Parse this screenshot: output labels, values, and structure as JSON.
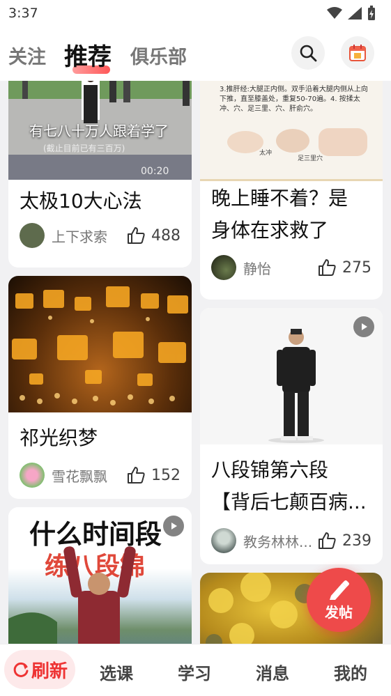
{
  "status": {
    "time": "3:37"
  },
  "tabs": {
    "follow": "关注",
    "recommend": "推荐",
    "club": "俱乐部"
  },
  "cards": [
    {
      "title": "太极10大心法",
      "author": "上下求索",
      "likes": "488",
      "thumb_text_main": "有七八十万人跟着学了",
      "thumb_text_sub": "(截止目前已有三百万)",
      "duration": "00:20"
    },
    {
      "title_line1": "晚上睡不着？是",
      "title_line2": "身体在求救了",
      "author": "静怡",
      "likes": "275",
      "thumb_text": "3.推肝经:大腿正内侧。双手沿着大腿内侧从上向下推，直至膝盖处，重复50-70遍。4. 按揉太冲、穴、足三里、穴、肝俞穴。",
      "thumb_label1": "太冲",
      "thumb_label2": "足三里穴"
    },
    {
      "title": "祁光织梦",
      "author": "雪花飘飘",
      "likes": "152"
    },
    {
      "title_line1": "八段锦第六段",
      "title_line2": "【背后七颠百病...",
      "author": "教务林林...",
      "likes": "239"
    },
    {
      "thumb_text_1": "什么时间段",
      "thumb_text_2": "练八段锦"
    },
    {}
  ],
  "fab": {
    "label": "发帖"
  },
  "bottom_nav": {
    "refresh": "刷新",
    "courses": "选课",
    "study": "学习",
    "messages": "消息",
    "mine": "我的"
  },
  "icons": {
    "search": "search-icon",
    "checkin": "calendar-sign-icon",
    "like": "thumb-up-icon",
    "play": "play-icon",
    "post": "pen-icon",
    "refresh": "refresh-icon"
  },
  "colors": {
    "accent": "#ee4a4a",
    "refresh_bg": "#fde9ea"
  }
}
